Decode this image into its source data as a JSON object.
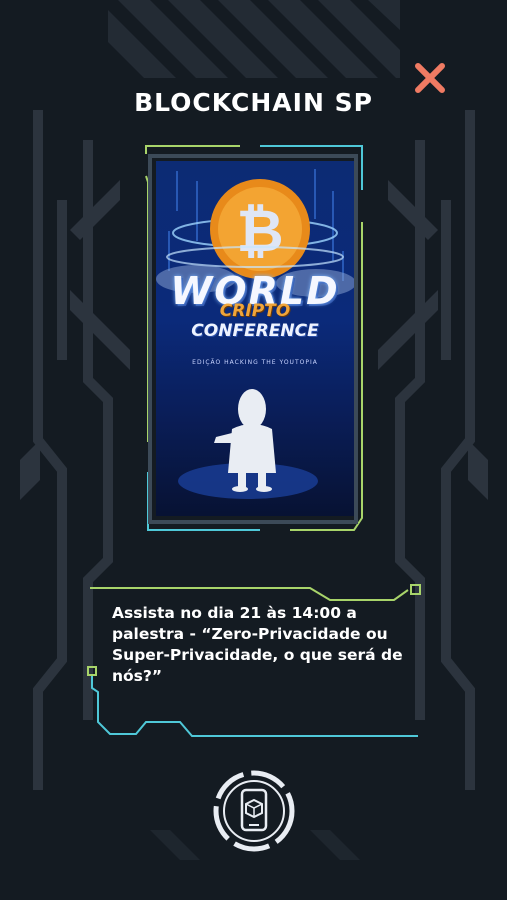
{
  "header": {
    "title": "BLOCKCHAIN SP",
    "close_icon": "close-icon"
  },
  "poster": {
    "title_line1": "WORLD",
    "title_line2": "CRIPTO",
    "title_line3": "CONFERENCE",
    "subtitle": "EDIÇÃO HACKING THE YOUTOPIA",
    "coin_icon": "bitcoin-coin-icon",
    "figure_icon": "speaker-silhouette-icon"
  },
  "description": "Assista no dia 21 às 14:00 a palestra - “Zero-Privacidade ou Super-Privacidade, o que será de nós?”",
  "footer": {
    "ar_icon": "augmented-reality-phone-icon"
  },
  "colors": {
    "background": "#141b22",
    "accent_close": "#f07b63",
    "frame_green": "#a8d46a",
    "frame_cyan": "#4fc8d8"
  }
}
